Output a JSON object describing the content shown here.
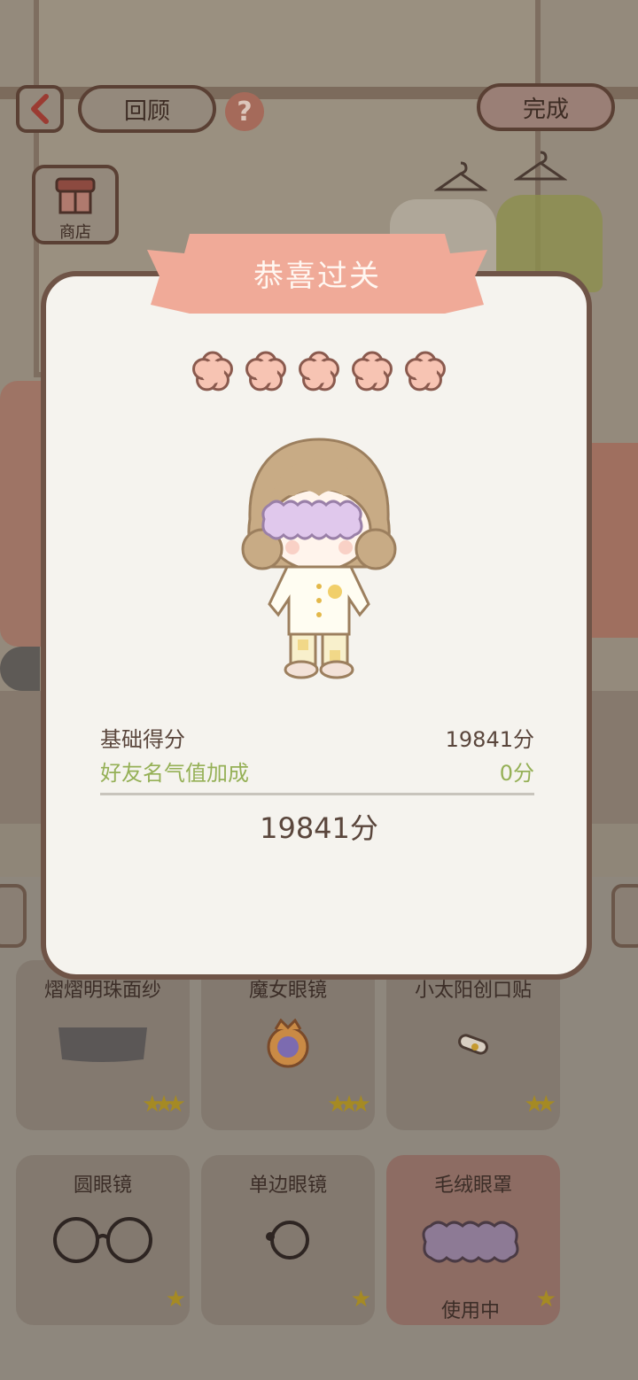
{
  "top_bar": {
    "review_label": "回顾",
    "done_label": "完成",
    "help_icon_glyph": "?"
  },
  "shop": {
    "label": "商店"
  },
  "modal": {
    "title": "恭喜过关",
    "stars_filled": 5,
    "stars_total": 5,
    "base_score_label": "基础得分",
    "base_score_value": "19841分",
    "bonus_label": "好友名气值加成",
    "bonus_value": "0分",
    "total_score": "19841分"
  },
  "items": [
    {
      "label": "熠熠明珠面纱",
      "rarity": "★★★",
      "icon": "veil-icon",
      "active": false
    },
    {
      "label": "魔女眼镜",
      "rarity": "★★★",
      "icon": "witch-glasses-icon",
      "active": false
    },
    {
      "label": "小太阳创口贴",
      "rarity": "★★",
      "icon": "bandage-icon",
      "active": false
    },
    {
      "label": "圆眼镜",
      "rarity": "★",
      "icon": "round-glasses-icon",
      "active": false
    },
    {
      "label": "单边眼镜",
      "rarity": "★",
      "icon": "monocle-icon",
      "active": false
    },
    {
      "label": "毛绒眼罩",
      "rarity": "★",
      "icon": "plush-eyemask-icon",
      "active": true,
      "status": "使用中"
    }
  ],
  "colors": {
    "accent_pink": "#f0aa98",
    "star_fill": "#f7c4b3",
    "bonus_green": "#95b056",
    "border_brown": "#6f5447"
  }
}
